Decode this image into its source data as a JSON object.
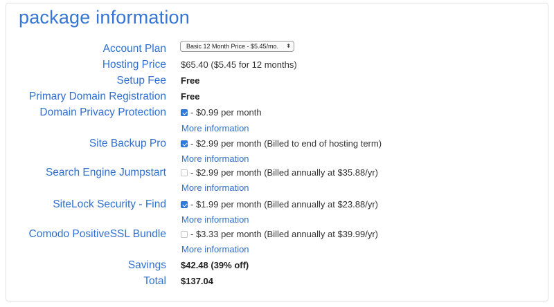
{
  "title": "package information",
  "account_plan": {
    "label": "Account Plan",
    "selected": "Basic 12 Month Price - $5.45/mo.",
    "arrows": "⬍"
  },
  "hosting_price": {
    "label": "Hosting Price",
    "value": "$65.40  ($5.45 for 12 months)"
  },
  "setup_fee": {
    "label": "Setup Fee",
    "value": "Free"
  },
  "domain_registration": {
    "label": "Primary Domain Registration",
    "value": "Free"
  },
  "addons": [
    {
      "label": "Domain Privacy Protection",
      "checked": true,
      "text": "- $0.99 per month",
      "more": "More information"
    },
    {
      "label": "Site Backup Pro",
      "checked": true,
      "text": "- $2.99 per month (Billed to end of hosting term)",
      "more": "More information"
    },
    {
      "label": "Search Engine Jumpstart",
      "checked": false,
      "text": "- $2.99 per month (Billed annually at $35.88/yr)",
      "more": "More information"
    },
    {
      "label": "SiteLock Security - Find",
      "checked": true,
      "text": "- $1.99 per month (Billed annually at $23.88/yr)",
      "more": "More information"
    },
    {
      "label": "Comodo PositiveSSL Bundle",
      "checked": false,
      "text": "- $3.33 per month (Billed annually at $39.99/yr)",
      "more": "More information"
    }
  ],
  "savings": {
    "label": "Savings",
    "value": "$42.48 (39% off)"
  },
  "total": {
    "label": "Total",
    "value": "$137.04"
  }
}
